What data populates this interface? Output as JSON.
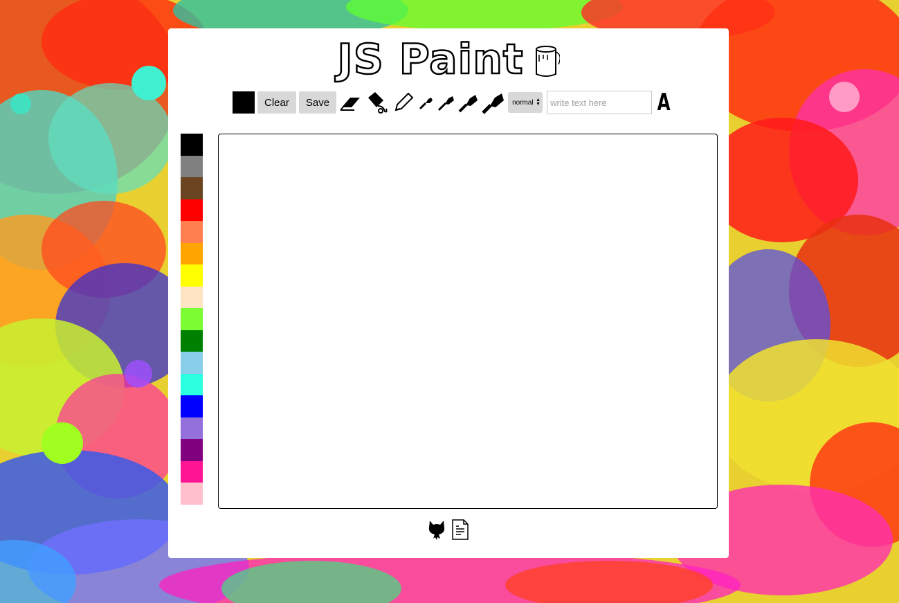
{
  "app": {
    "title": "JS Paint"
  },
  "colors": {
    "accent_current": "#000000",
    "button_bg": "#d8d8d8",
    "panel_bg": "#ffffff"
  },
  "toolbar": {
    "current_color": "#000000",
    "clear_label": "Clear",
    "save_label": "Save",
    "tools": [
      "eraser-icon",
      "paint-bucket-icon",
      "pencil-icon",
      "brush-small-icon",
      "brush-medium-icon",
      "brush-large-icon",
      "brush-xlarge-icon"
    ],
    "blend_mode_value": "normal",
    "text_input_placeholder": "write text here",
    "text_tool_label": "A"
  },
  "palette": {
    "colors": [
      "#000000",
      "#808080",
      "#6b4422",
      "#ff0000",
      "#ff7f50",
      "#ffa500",
      "#ffff00",
      "#ffe4c4",
      "#7cfc32",
      "#008000",
      "#87ceeb",
      "#2affe0",
      "#0000ff",
      "#9370db",
      "#800080",
      "#ff1493",
      "#ffc0cb"
    ]
  },
  "footer": {
    "icons": [
      "github-icon",
      "license-document-icon"
    ]
  }
}
